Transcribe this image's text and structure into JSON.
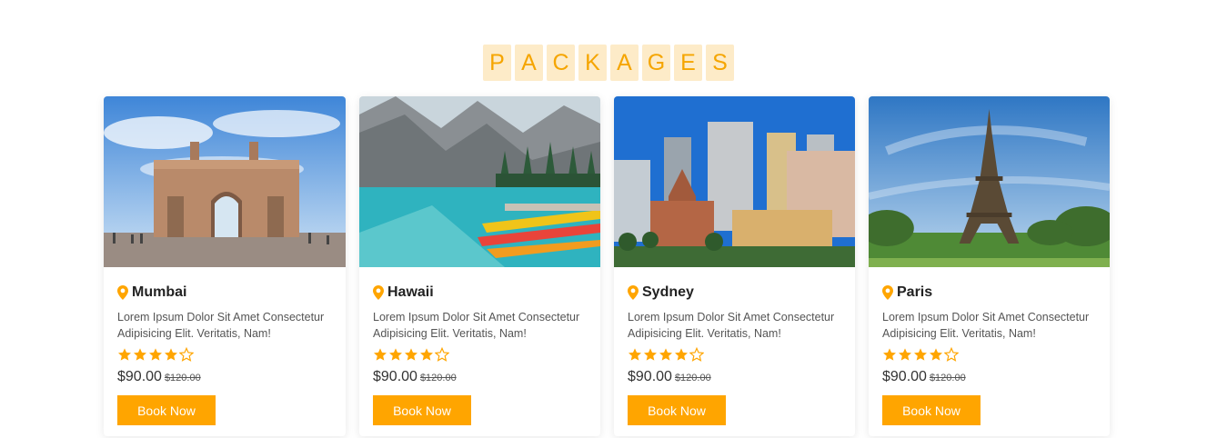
{
  "section": {
    "title_letters": [
      "P",
      "A",
      "C",
      "K",
      "A",
      "G",
      "E",
      "S"
    ]
  },
  "colors": {
    "accent": "#ffa500",
    "title_bg": "#fdebc8",
    "title_text": "#f5a500"
  },
  "packages": [
    {
      "location": "Mumbai",
      "image_icon": "gateway-of-india-photo",
      "description": "Lorem Ipsum Dolor Sit Amet Consectetur Adipisicing Elit. Veritatis, Nam!",
      "rating": 4,
      "rating_max": 5,
      "price": "$90.00",
      "old_price": "$120.00",
      "button_label": "Book Now"
    },
    {
      "location": "Hawaii",
      "image_icon": "mountain-lake-photo",
      "description": "Lorem Ipsum Dolor Sit Amet Consectetur Adipisicing Elit. Veritatis, Nam!",
      "rating": 4,
      "rating_max": 5,
      "price": "$90.00",
      "old_price": "$120.00",
      "button_label": "Book Now"
    },
    {
      "location": "Sydney",
      "image_icon": "city-skyline-photo",
      "description": "Lorem Ipsum Dolor Sit Amet Consectetur Adipisicing Elit. Veritatis, Nam!",
      "rating": 4,
      "rating_max": 5,
      "price": "$90.00",
      "old_price": "$120.00",
      "button_label": "Book Now"
    },
    {
      "location": "Paris",
      "image_icon": "eiffel-tower-photo",
      "description": "Lorem Ipsum Dolor Sit Amet Consectetur Adipisicing Elit. Veritatis, Nam!",
      "rating": 4,
      "rating_max": 5,
      "price": "$90.00",
      "old_price": "$120.00",
      "button_label": "Book Now"
    }
  ]
}
